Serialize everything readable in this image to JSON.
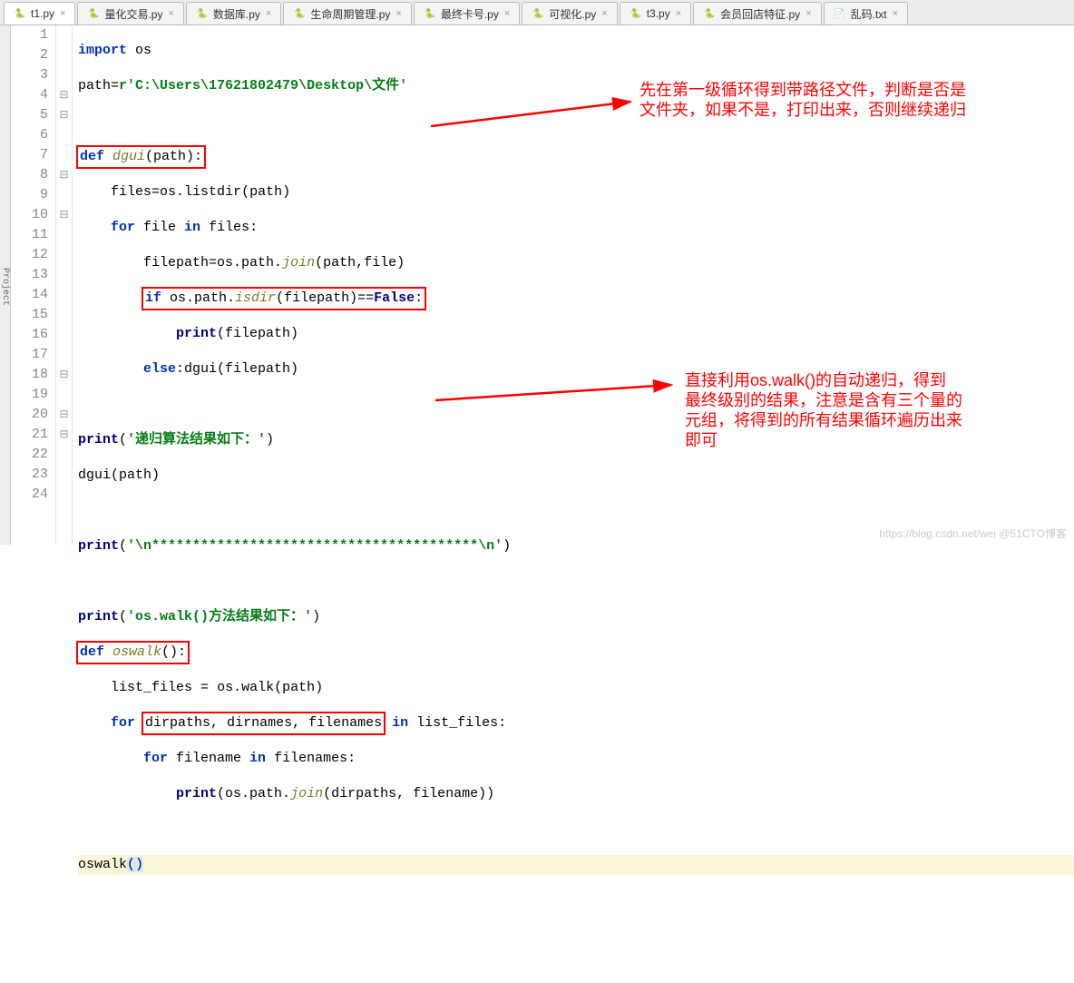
{
  "tabs": [
    {
      "label": "t1.py",
      "icon": "py",
      "active": true
    },
    {
      "label": "量化交易.py",
      "icon": "py"
    },
    {
      "label": "数据库.py",
      "icon": "py"
    },
    {
      "label": "生命周期管理.py",
      "icon": "py"
    },
    {
      "label": "最终卡号.py",
      "icon": "py"
    },
    {
      "label": "可视化.py",
      "icon": "py"
    },
    {
      "label": "t3.py",
      "icon": "py"
    },
    {
      "label": "会员回店特征.py",
      "icon": "py"
    },
    {
      "label": "乱码.txt",
      "icon": "tx"
    }
  ],
  "lineStart": 1,
  "lineEnd": 24,
  "fold": {
    "4": "⊟",
    "5": "⊟",
    "8": "⊟",
    "10": "⊟",
    "18": "⊟",
    "20": "⊟",
    "21": "⊟"
  },
  "code": {
    "l1": {
      "a": "import",
      "b": " os"
    },
    "l2": {
      "a": "path",
      "b": "=",
      "c": "r'C:\\Users\\17621802479\\Desktop\\文件'"
    },
    "l4": {
      "pre": "",
      "a": "def",
      "b": " dgui",
      "c": "(path):"
    },
    "l5": {
      "pre": "    ",
      "a": "files",
      "b": "=",
      "c": "os.listdir",
      "d": "(path)"
    },
    "l6": {
      "pre": "    ",
      "a": "for",
      "b": " file ",
      "c": "in",
      "d": " files:"
    },
    "l7": {
      "pre": "        ",
      "a": "filepath",
      "b": "=",
      "c": "os.path.",
      "d": "join",
      "e": "(path,file)"
    },
    "l8": {
      "pre": "        ",
      "a": "if",
      "b": " os.path.",
      "c": "isdir",
      "d": "(filepath)",
      "e": "==",
      "f": "False",
      "g": ":"
    },
    "l9": {
      "pre": "            ",
      "a": "print",
      "b": "(filepath)"
    },
    "l10": {
      "pre": "        ",
      "a": "else",
      "b": ":dgui(filepath)"
    },
    "l12": {
      "pre": "",
      "a": "print",
      "b": "(",
      "c": "'递归算法结果如下：'",
      "d": ")"
    },
    "l13": {
      "pre": "",
      "a": "dgui(path)"
    },
    "l15": {
      "pre": "",
      "a": "print",
      "b": "(",
      "c": "'\\n****************************************\\n'",
      "d": ")"
    },
    "l17": {
      "pre": "",
      "a": "print",
      "b": "(",
      "c": "'os.walk()方法结果如下：'",
      "d": ")"
    },
    "l18": {
      "pre": "",
      "a": "def",
      "b": " oswalk",
      "c": "():"
    },
    "l19": {
      "pre": "    ",
      "a": "list_files ",
      "b": "=",
      "c": " os.walk(path)"
    },
    "l20": {
      "pre": "    ",
      "a": "for",
      "b": " ",
      "c": "dirpaths, dirnames, filenames",
      "d": " ",
      "e": "in",
      "f": " list_files:"
    },
    "l21": {
      "pre": "        ",
      "a": "for",
      "b": " filename ",
      "c": "in",
      "d": " filenames:"
    },
    "l22": {
      "pre": "            ",
      "a": "print",
      "b": "(os.path.",
      "c": "join",
      "d": "(dirpaths, filename))"
    },
    "l24": {
      "pre": "",
      "a": "oswalk",
      "b": "()"
    }
  },
  "notes": {
    "n1": "先在第一级循环得到带路径文件，判断是否是\n文件夹，如果不是，打印出来，否则继续递归",
    "n2": "直接利用os.walk()的自动递归，得到\n最终级别的结果，注意是含有三个量的\n元组，将得到的所有结果循环遍历出来\n即可"
  },
  "tabClose": "×",
  "sideLabel": "Project",
  "watermark": "https://blog.csdn.net/wei  @51CTO博客"
}
